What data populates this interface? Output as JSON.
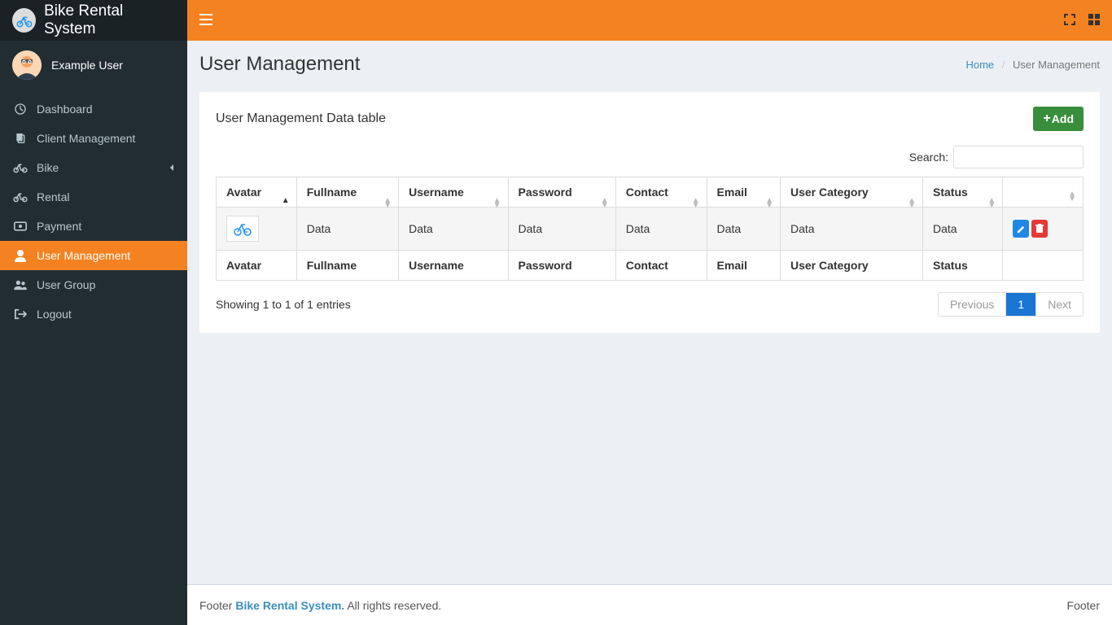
{
  "brand": "Bike Rental System",
  "user": {
    "name": "Example User"
  },
  "sidebar": {
    "items": [
      {
        "label": "Dashboard",
        "icon": "dashboard-icon"
      },
      {
        "label": "Client Management",
        "icon": "clients-icon"
      },
      {
        "label": "Bike",
        "icon": "bike-icon",
        "hasChildren": true
      },
      {
        "label": "Rental",
        "icon": "rental-icon"
      },
      {
        "label": "Payment",
        "icon": "payment-icon"
      },
      {
        "label": "User Management",
        "icon": "user-icon",
        "active": true
      },
      {
        "label": "User Group",
        "icon": "users-icon"
      },
      {
        "label": "Logout",
        "icon": "logout-icon"
      }
    ]
  },
  "header": {
    "page_title": "User Management",
    "breadcrumb_home": "Home",
    "breadcrumb_current": "User Management"
  },
  "box": {
    "title": "User Management Data table",
    "add_label": "Add",
    "search_label": "Search:",
    "search_value": ""
  },
  "table": {
    "columns": [
      "Avatar",
      "Fullname",
      "Username",
      "Password",
      "Contact",
      "Email",
      "User Category",
      "Status"
    ],
    "rows": [
      {
        "avatar": "bike-logo",
        "fullname": "Data",
        "username": "Data",
        "password": "Data",
        "contact": "Data",
        "email": "Data",
        "user_category": "Data",
        "status": "Data"
      }
    ],
    "footer": [
      "Avatar",
      "Fullname",
      "Username",
      "Password",
      "Contact",
      "Email",
      "User Category",
      "Status"
    ],
    "info": "Showing 1 to 1 of 1 entries",
    "pagination": {
      "previous": "Previous",
      "next": "Next",
      "pages": [
        "1"
      ],
      "active": "1"
    }
  },
  "footer_text": {
    "lead": "Footer ",
    "brand": "Bike Rental System.",
    "rights": " All rights reserved.",
    "right": "Footer"
  }
}
